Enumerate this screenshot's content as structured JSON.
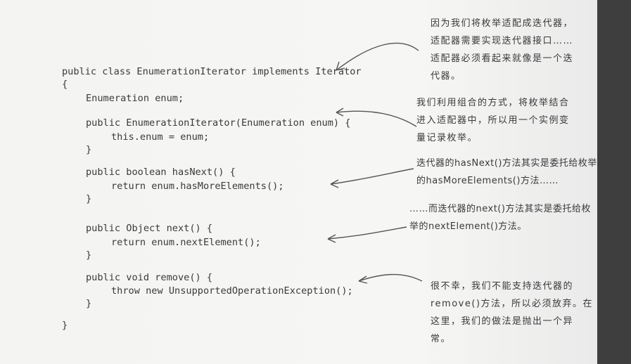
{
  "code": [
    "public class EnumerationIterator implements Iterator",
    "{",
    "Enumeration enum;",
    "public EnumerationIterator(Enumeration enum) {",
    "this.enum = enum;",
    "}",
    "public boolean hasNext() {",
    "return enum.hasMoreElements();",
    "}",
    "public Object next() {",
    "return enum.nextElement();",
    "}",
    "public void remove() {",
    "throw new UnsupportedOperationException();",
    "}",
    "}"
  ],
  "notes": {
    "adapter": [
      "因为我们将枚举适配成迭代器，",
      "适配器需要实现迭代器接口……",
      "适配器必须看起来就像是一个迭",
      "代器。"
    ],
    "composition": [
      "我们利用组合的方式，将枚举结合",
      "进入适配器中，所以用一个实例变",
      "量记录枚举。"
    ],
    "hasnext": [
      "迭代器的hasNext()方法其实是委托给枚举",
      "的hasMoreElements()方法……"
    ],
    "next": [
      "……而迭代器的next()方法其实是委托给枚",
      "举的nextElement()方法。"
    ],
    "remove": [
      "很不幸，我们不能支持迭代器的",
      "remove()方法，所以必须放弃。在",
      "这里，我们的做法是抛出一个异",
      "常。"
    ]
  }
}
